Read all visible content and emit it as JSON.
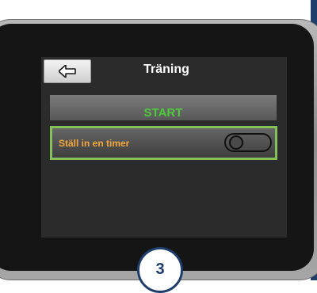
{
  "screen": {
    "title": "Träning",
    "back_icon": "arrow-left-icon",
    "start_label": "START",
    "timer_label": "Ställ in en timer",
    "timer_toggle_on": false
  },
  "step_badge": "3",
  "colors": {
    "start_text": "#4ccc3b",
    "timer_text": "#f5a83a",
    "highlight_border": "#84c159",
    "accent_navy": "#1f3d6b"
  }
}
